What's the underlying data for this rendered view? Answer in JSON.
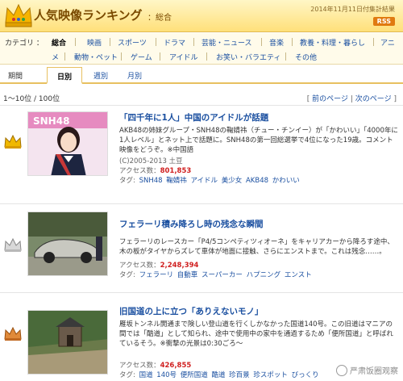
{
  "header": {
    "title": "人気映像ランキング",
    "subtitle": "：総合",
    "date_note": "2014年11月11日付集計結果",
    "rss": "RSS"
  },
  "category": {
    "label": "カテゴリ ：",
    "items": [
      {
        "label": "総合",
        "active": true
      },
      {
        "label": "映画"
      },
      {
        "label": "スポーツ"
      },
      {
        "label": "ドラマ"
      },
      {
        "label": "芸能・ニュース"
      },
      {
        "label": "音楽"
      },
      {
        "label": "教養・料理・暮らし"
      },
      {
        "label": "アニ"
      },
      {
        "label": "メ"
      },
      {
        "label": "動物・ペット"
      },
      {
        "label": "ゲーム"
      },
      {
        "label": "アイドル"
      },
      {
        "label": "お笑い・バラエティ"
      },
      {
        "label": "その他"
      }
    ]
  },
  "period": {
    "label": "期間",
    "tabs": [
      {
        "label": "日別",
        "active": true
      },
      {
        "label": "週別"
      },
      {
        "label": "月別"
      }
    ]
  },
  "pagination": {
    "range": "1～10位 / 100位",
    "prev": "前のページ",
    "next": "次のページ",
    "bracket_open": "[",
    "bracket_sep": "|",
    "bracket_close": "]"
  },
  "entries": [
    {
      "rank_crown": "gold",
      "title": "「四千年に1人」中国のアイドルが話題",
      "desc": "AKB48の姉妹グループ・SNH48の鞠婧祎（チュー・チンイー）が「かわいい」「4000年に1人レベル」とネット上で話題に。SNH48の第一回総選挙で4位になった19歳。コメント映像をどうぞ。※中国語",
      "copyright": "(C)2005-2013 土豆",
      "views_label": "アクセス数：",
      "views": "801,853",
      "tags_label": "タグ:",
      "tags": [
        "SNH48",
        "鞠婧祎",
        "アイドル",
        "美少女",
        "AKB48",
        "かわいい"
      ]
    },
    {
      "rank_crown": "silver",
      "title": "フェラーリ積み降ろし時の残念な瞬間",
      "desc": "フェラーリのレースカー「P4/5コンペティツィオーネ」をキャリアカーから降ろす途中、木の板がタイヤからズレて車体が地面に接触、さらにエンストまで。これは残念……。",
      "copyright": "",
      "views_label": "アクセス数：",
      "views": "2,248,394",
      "tags_label": "タグ:",
      "tags": [
        "フェラーリ",
        "自動車",
        "スーパーカー",
        "ハプニング",
        "エンスト"
      ]
    },
    {
      "rank_crown": "bronze",
      "title": "旧国道の上に立つ「ありえないモノ」",
      "desc": "雁坂トンネル開通まで険しい登山道を行くしかなかった国道140号。この旧道はマニアの間では「酷道」として知られ、途中で使用中の家中を通過するため「便所国道」と呼ばれているそう。※衝撃の光景は0:30ごろ～",
      "copyright": "",
      "views_label": "アクセス数：",
      "views": "426,855",
      "tags_label": "タグ:",
      "tags": [
        "国道",
        "140号",
        "便所国道",
        "酷道",
        "珍百景",
        "珍スポット",
        "びっくり"
      ]
    }
  ],
  "thumb1_banner": "SNH48",
  "watermark": "严肃饭圈观察",
  "colors": {
    "header_top": "#fff6c6",
    "header_bottom": "#ffe07a",
    "link": "#1a4fa0",
    "views": "#d02020"
  }
}
